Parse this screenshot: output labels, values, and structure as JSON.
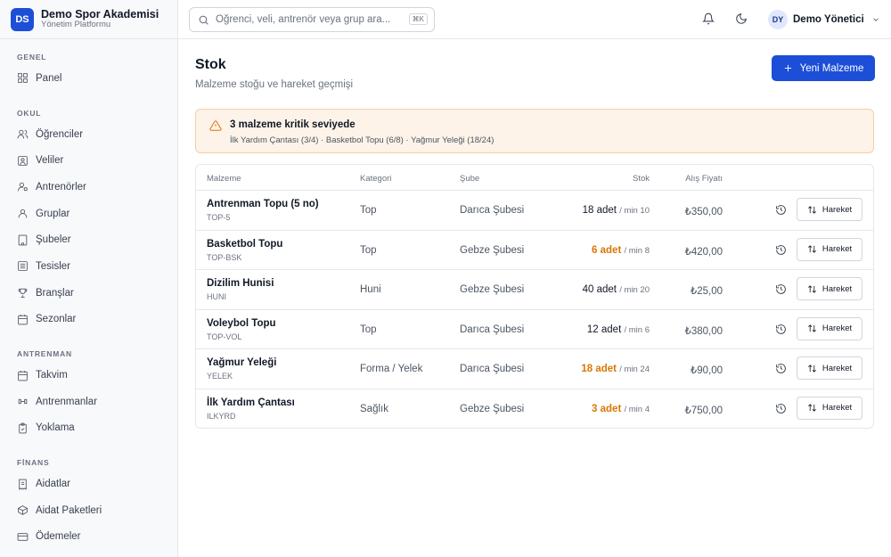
{
  "brand": {
    "logo": "DS",
    "name": "Demo Spor Akademisi",
    "subtitle": "Yönetim Platformu"
  },
  "sidebar": {
    "sections": [
      {
        "title": "GENEL",
        "items": [
          {
            "label": "Panel",
            "icon": "dashboard-icon"
          }
        ]
      },
      {
        "title": "OKUL",
        "items": [
          {
            "label": "Öğrenciler",
            "icon": "students-icon"
          },
          {
            "label": "Veliler",
            "icon": "parents-icon"
          },
          {
            "label": "Antrenörler",
            "icon": "coaches-icon"
          },
          {
            "label": "Gruplar",
            "icon": "groups-icon"
          },
          {
            "label": "Şubeler",
            "icon": "building-icon"
          },
          {
            "label": "Tesisler",
            "icon": "facility-icon"
          },
          {
            "label": "Branşlar",
            "icon": "trophy-icon"
          },
          {
            "label": "Sezonlar",
            "icon": "calendar-icon"
          }
        ]
      },
      {
        "title": "ANTRENMAN",
        "items": [
          {
            "label": "Takvim",
            "icon": "calendar-icon"
          },
          {
            "label": "Antrenmanlar",
            "icon": "training-icon"
          },
          {
            "label": "Yoklama",
            "icon": "clipboard-check-icon"
          }
        ]
      },
      {
        "title": "FİNANS",
        "items": [
          {
            "label": "Aidatlar",
            "icon": "receipt-icon"
          },
          {
            "label": "Aidat Paketleri",
            "icon": "package-icon"
          },
          {
            "label": "Ödemeler",
            "icon": "credit-card-icon"
          }
        ]
      }
    ]
  },
  "topbar": {
    "search_placeholder": "Öğrenci, veli, antrenör veya grup ara...",
    "search_shortcut": "⌘K",
    "user_initials": "DY",
    "user_name": "Demo Yönetici"
  },
  "page": {
    "title": "Stok",
    "subtitle": "Malzeme stoğu ve hareket geçmişi",
    "new_button": "Yeni Malzeme"
  },
  "alert": {
    "title": "3 malzeme kritik seviyede",
    "detail": "İlk Yardım Çantası (3/4) · Basketbol Topu (6/8) · Yağmur Yeleği (18/24)"
  },
  "table": {
    "headers": {
      "name": "Malzeme",
      "category": "Kategori",
      "branch": "Şube",
      "stock": "Stok",
      "price": "Alış Fiyatı"
    },
    "action_label": "Hareket",
    "rows": [
      {
        "name": "Antrenman Topu (5 no)",
        "code": "TOP-5",
        "category": "Top",
        "branch": "Darıca Şubesi",
        "stock": "18 adet",
        "min": "/ min 10",
        "low": false,
        "price": "₺350,00"
      },
      {
        "name": "Basketbol Topu",
        "code": "TOP-BSK",
        "category": "Top",
        "branch": "Gebze Şubesi",
        "stock": "6 adet",
        "min": "/ min 8",
        "low": true,
        "price": "₺420,00"
      },
      {
        "name": "Dizilim Hunisi",
        "code": "HUNI",
        "category": "Huni",
        "branch": "Gebze Şubesi",
        "stock": "40 adet",
        "min": "/ min 20",
        "low": false,
        "price": "₺25,00"
      },
      {
        "name": "Voleybol Topu",
        "code": "TOP-VOL",
        "category": "Top",
        "branch": "Darıca Şubesi",
        "stock": "12 adet",
        "min": "/ min 6",
        "low": false,
        "price": "₺380,00"
      },
      {
        "name": "Yağmur Yeleği",
        "code": "YELEK",
        "category": "Forma / Yelek",
        "branch": "Darıca Şubesi",
        "stock": "18 adet",
        "min": "/ min 24",
        "low": true,
        "price": "₺90,00"
      },
      {
        "name": "İlk Yardım Çantası",
        "code": "ILKYRD",
        "category": "Sağlık",
        "branch": "Gebze Şubesi",
        "stock": "3 adet",
        "min": "/ min 4",
        "low": true,
        "price": "₺750,00"
      }
    ]
  },
  "colors": {
    "primary": "#1d4ed8",
    "warning": "#d97706",
    "alert_bg": "#fdf3e8"
  }
}
